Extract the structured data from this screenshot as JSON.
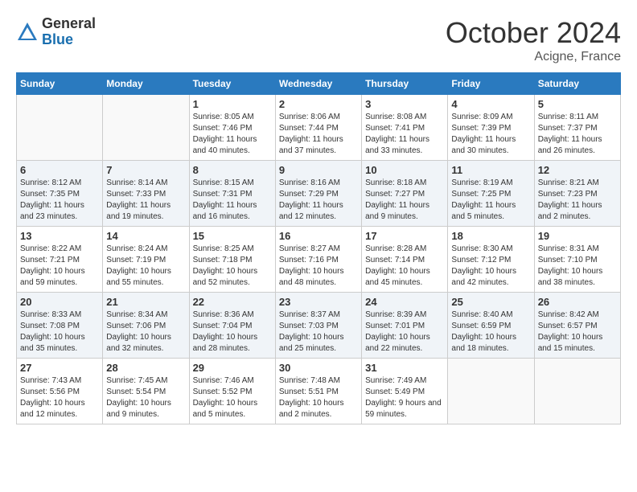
{
  "header": {
    "logo_general": "General",
    "logo_blue": "Blue",
    "month_title": "October 2024",
    "location": "Acigne, France"
  },
  "weekdays": [
    "Sunday",
    "Monday",
    "Tuesday",
    "Wednesday",
    "Thursday",
    "Friday",
    "Saturday"
  ],
  "weeks": [
    [
      {
        "day": "",
        "info": ""
      },
      {
        "day": "",
        "info": ""
      },
      {
        "day": "1",
        "info": "Sunrise: 8:05 AM\nSunset: 7:46 PM\nDaylight: 11 hours and 40 minutes."
      },
      {
        "day": "2",
        "info": "Sunrise: 8:06 AM\nSunset: 7:44 PM\nDaylight: 11 hours and 37 minutes."
      },
      {
        "day": "3",
        "info": "Sunrise: 8:08 AM\nSunset: 7:41 PM\nDaylight: 11 hours and 33 minutes."
      },
      {
        "day": "4",
        "info": "Sunrise: 8:09 AM\nSunset: 7:39 PM\nDaylight: 11 hours and 30 minutes."
      },
      {
        "day": "5",
        "info": "Sunrise: 8:11 AM\nSunset: 7:37 PM\nDaylight: 11 hours and 26 minutes."
      }
    ],
    [
      {
        "day": "6",
        "info": "Sunrise: 8:12 AM\nSunset: 7:35 PM\nDaylight: 11 hours and 23 minutes."
      },
      {
        "day": "7",
        "info": "Sunrise: 8:14 AM\nSunset: 7:33 PM\nDaylight: 11 hours and 19 minutes."
      },
      {
        "day": "8",
        "info": "Sunrise: 8:15 AM\nSunset: 7:31 PM\nDaylight: 11 hours and 16 minutes."
      },
      {
        "day": "9",
        "info": "Sunrise: 8:16 AM\nSunset: 7:29 PM\nDaylight: 11 hours and 12 minutes."
      },
      {
        "day": "10",
        "info": "Sunrise: 8:18 AM\nSunset: 7:27 PM\nDaylight: 11 hours and 9 minutes."
      },
      {
        "day": "11",
        "info": "Sunrise: 8:19 AM\nSunset: 7:25 PM\nDaylight: 11 hours and 5 minutes."
      },
      {
        "day": "12",
        "info": "Sunrise: 8:21 AM\nSunset: 7:23 PM\nDaylight: 11 hours and 2 minutes."
      }
    ],
    [
      {
        "day": "13",
        "info": "Sunrise: 8:22 AM\nSunset: 7:21 PM\nDaylight: 10 hours and 59 minutes."
      },
      {
        "day": "14",
        "info": "Sunrise: 8:24 AM\nSunset: 7:19 PM\nDaylight: 10 hours and 55 minutes."
      },
      {
        "day": "15",
        "info": "Sunrise: 8:25 AM\nSunset: 7:18 PM\nDaylight: 10 hours and 52 minutes."
      },
      {
        "day": "16",
        "info": "Sunrise: 8:27 AM\nSunset: 7:16 PM\nDaylight: 10 hours and 48 minutes."
      },
      {
        "day": "17",
        "info": "Sunrise: 8:28 AM\nSunset: 7:14 PM\nDaylight: 10 hours and 45 minutes."
      },
      {
        "day": "18",
        "info": "Sunrise: 8:30 AM\nSunset: 7:12 PM\nDaylight: 10 hours and 42 minutes."
      },
      {
        "day": "19",
        "info": "Sunrise: 8:31 AM\nSunset: 7:10 PM\nDaylight: 10 hours and 38 minutes."
      }
    ],
    [
      {
        "day": "20",
        "info": "Sunrise: 8:33 AM\nSunset: 7:08 PM\nDaylight: 10 hours and 35 minutes."
      },
      {
        "day": "21",
        "info": "Sunrise: 8:34 AM\nSunset: 7:06 PM\nDaylight: 10 hours and 32 minutes."
      },
      {
        "day": "22",
        "info": "Sunrise: 8:36 AM\nSunset: 7:04 PM\nDaylight: 10 hours and 28 minutes."
      },
      {
        "day": "23",
        "info": "Sunrise: 8:37 AM\nSunset: 7:03 PM\nDaylight: 10 hours and 25 minutes."
      },
      {
        "day": "24",
        "info": "Sunrise: 8:39 AM\nSunset: 7:01 PM\nDaylight: 10 hours and 22 minutes."
      },
      {
        "day": "25",
        "info": "Sunrise: 8:40 AM\nSunset: 6:59 PM\nDaylight: 10 hours and 18 minutes."
      },
      {
        "day": "26",
        "info": "Sunrise: 8:42 AM\nSunset: 6:57 PM\nDaylight: 10 hours and 15 minutes."
      }
    ],
    [
      {
        "day": "27",
        "info": "Sunrise: 7:43 AM\nSunset: 5:56 PM\nDaylight: 10 hours and 12 minutes."
      },
      {
        "day": "28",
        "info": "Sunrise: 7:45 AM\nSunset: 5:54 PM\nDaylight: 10 hours and 9 minutes."
      },
      {
        "day": "29",
        "info": "Sunrise: 7:46 AM\nSunset: 5:52 PM\nDaylight: 10 hours and 5 minutes."
      },
      {
        "day": "30",
        "info": "Sunrise: 7:48 AM\nSunset: 5:51 PM\nDaylight: 10 hours and 2 minutes."
      },
      {
        "day": "31",
        "info": "Sunrise: 7:49 AM\nSunset: 5:49 PM\nDaylight: 9 hours and 59 minutes."
      },
      {
        "day": "",
        "info": ""
      },
      {
        "day": "",
        "info": ""
      }
    ]
  ]
}
